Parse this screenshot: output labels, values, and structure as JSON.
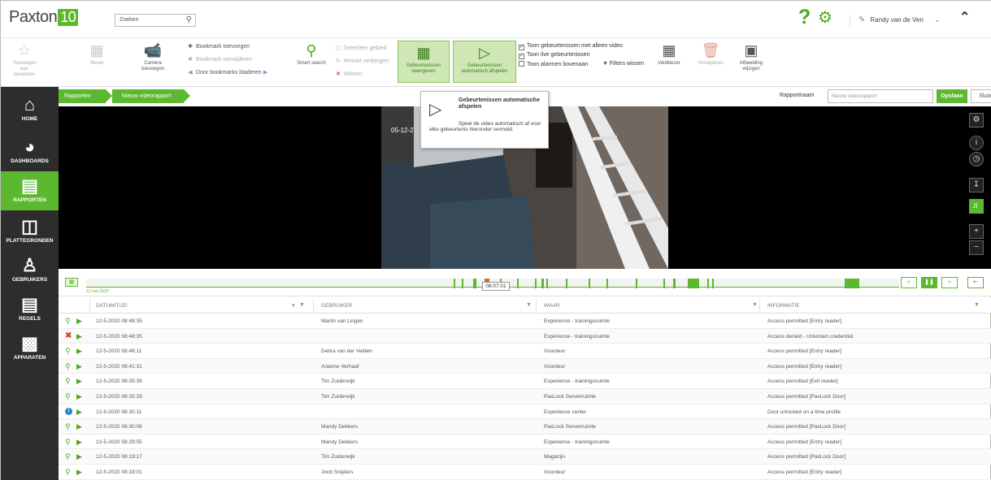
{
  "app": {
    "logo_text": "Paxton",
    "logo_badge": "10"
  },
  "search": {
    "value": "Zoeken"
  },
  "user": {
    "name": "Randy van de Ven"
  },
  "ribbon": {
    "favorites": "Toevoegen aan favorieten",
    "new": "Nieuw",
    "add_camera": "Camera toevoegen",
    "bookmark_add": "Bookmark toevoegen",
    "bookmark_remove": "Bookmark verwijderen",
    "bookmark_browse": "Door bookmarks bladeren",
    "smart_search": "Smart search",
    "select_area": "Selecteer gebied",
    "reset_hide": "Resset verbergen",
    "clear": "Wissen",
    "show_events": "Gebeurtenissen weergeven",
    "autoplay_events": "Gebeurtenissen automatisch afspelen",
    "chk_video_only": "Toon gebeurtenissen met alleen video",
    "chk_live": "Toon live gebeurtenissen",
    "chk_alarms_top": "Toon alarmen bovenaan",
    "filters_clear": "Filters wissen",
    "field_selector": "Veldkiezer",
    "delete": "Verwijderen",
    "change_image": "Afbeelding wijzigen"
  },
  "sidebar": {
    "items": [
      {
        "label": "HOME",
        "icon": "home-icon"
      },
      {
        "label": "DASHBOARDS",
        "icon": "dashboard-icon"
      },
      {
        "label": "RAPPORTEN",
        "icon": "reports-icon"
      },
      {
        "label": "PLATTEGRONDEN",
        "icon": "floorplan-icon"
      },
      {
        "label": "GEBRUIKERS",
        "icon": "user-icon"
      },
      {
        "label": "REGELS",
        "icon": "rules-icon"
      },
      {
        "label": "APPARATEN",
        "icon": "devices-icon"
      }
    ]
  },
  "breadcrumb": {
    "item1": "Rapporten",
    "item2": "Nieuw videorapport"
  },
  "report": {
    "name_label": "Rapportnaam",
    "name_placeholder": "Nieuw videorapport",
    "save": "Opslaan",
    "close": "Sluiten"
  },
  "video": {
    "timestamp": "05-12-2"
  },
  "tooltip": {
    "title": "Gebeurtenissen automatische afspelen",
    "description": "Speel de video automatisch af voor elke gebeurtenis hieronder vermeld."
  },
  "timeline": {
    "date": "12 mei 2020",
    "cursor_time": "08:07:01"
  },
  "table": {
    "headers": {
      "datetime": "DATUM/TIJD",
      "user": "GEBRUIKER",
      "where": "WAAR",
      "info": "INFORMATIE"
    },
    "rows": [
      {
        "icon": "key",
        "datetime": "12-5-2020 08:48:35",
        "user": "Martin van Lingen",
        "where": "Experience - trainingsruimte",
        "info": "Access permitted [Entry reader]"
      },
      {
        "icon": "x",
        "datetime": "12-5-2020 08:48:35",
        "user": "",
        "where": "Experience - trainingsruimte",
        "info": "Access denied - Unknown credential"
      },
      {
        "icon": "key",
        "datetime": "12-5-2020 08:46:11",
        "user": "Debra van der Velden",
        "where": "Voordeur",
        "info": "Access permitted [Entry reader]"
      },
      {
        "icon": "key",
        "datetime": "12-5-2020 08:41:31",
        "user": "Arianne Verhaaf",
        "where": "Voordeur",
        "info": "Access permitted [Entry reader]"
      },
      {
        "icon": "key",
        "datetime": "12-5-2020 08:35:36",
        "user": "Tim Zuiderwijk",
        "where": "Experience - trainingsruimte",
        "info": "Access permitted [Exit reader]"
      },
      {
        "icon": "key",
        "datetime": "12-5-2020 08:35:29",
        "user": "Tim Zuiderwijk",
        "where": "PaxLock Serverruimte",
        "info": "Access permitted [PaxLock Door]"
      },
      {
        "icon": "info",
        "datetime": "12-5-2020 08:30:11",
        "user": "",
        "where": "Experience center",
        "info": "Door unlocked on a time profile"
      },
      {
        "icon": "key",
        "datetime": "12-5-2020 08:30:06",
        "user": "Mandy Dekkers",
        "where": "PaxLock Serverruimte",
        "info": "Access permitted [PaxLock Door]"
      },
      {
        "icon": "key",
        "datetime": "12-5-2020 08:29:55",
        "user": "Mandy Dekkers",
        "where": "Experience - trainingsruimte",
        "info": "Access permitted [Entry reader]"
      },
      {
        "icon": "key",
        "datetime": "12-5-2020 08:19:17",
        "user": "Tim Zuiderwijk",
        "where": "Magazijn",
        "info": "Access permitted [PaxLock Door]"
      },
      {
        "icon": "key",
        "datetime": "12-5-2020 08:18:01",
        "user": "Jordi Snijders",
        "where": "Voordeur",
        "info": "Access permitted [Entry reader]"
      }
    ]
  },
  "colors": {
    "accent": "#5cb82e",
    "sidebar": "#2d2d2d",
    "denied": "#d34b2c",
    "info": "#2b7fd4"
  }
}
